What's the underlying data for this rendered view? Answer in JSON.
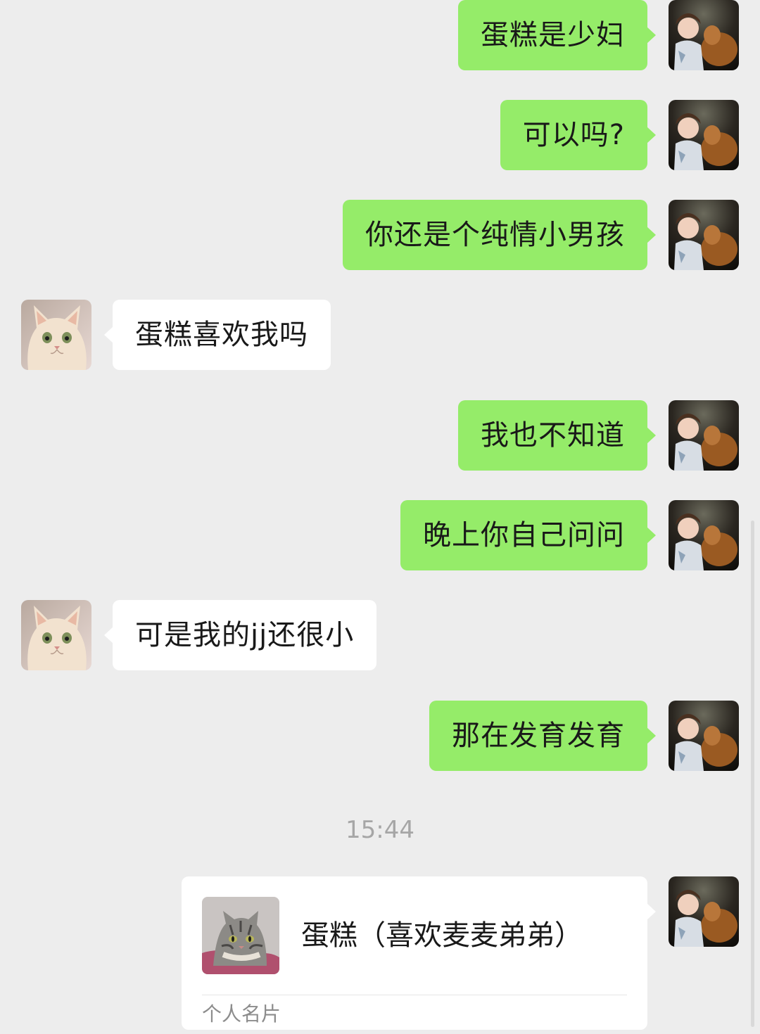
{
  "messages": [
    {
      "side": "me",
      "text": "蛋糕是少妇"
    },
    {
      "side": "me",
      "text": "可以吗?"
    },
    {
      "side": "me",
      "text": "你还是个纯情小男孩"
    },
    {
      "side": "them",
      "text": "蛋糕喜欢我吗"
    },
    {
      "side": "me",
      "text": "我也不知道"
    },
    {
      "side": "me",
      "text": "晚上你自己问问"
    },
    {
      "side": "them",
      "text": "可是我的jj还很小"
    },
    {
      "side": "me",
      "text": "那在发育发育"
    }
  ],
  "timestamp": "15:44",
  "contact_card": {
    "name": "蛋糕（喜欢麦麦弟弟）",
    "type_label": "个人名片"
  },
  "colors": {
    "background": "#EDEDED",
    "my_bubble": "#95EC69",
    "their_bubble": "#FFFFFF"
  },
  "icons": {
    "my_avatar": "girl-with-dog-photo",
    "their_avatar": "cream-cat-photo",
    "card_photo": "tabby-cat-photo"
  }
}
